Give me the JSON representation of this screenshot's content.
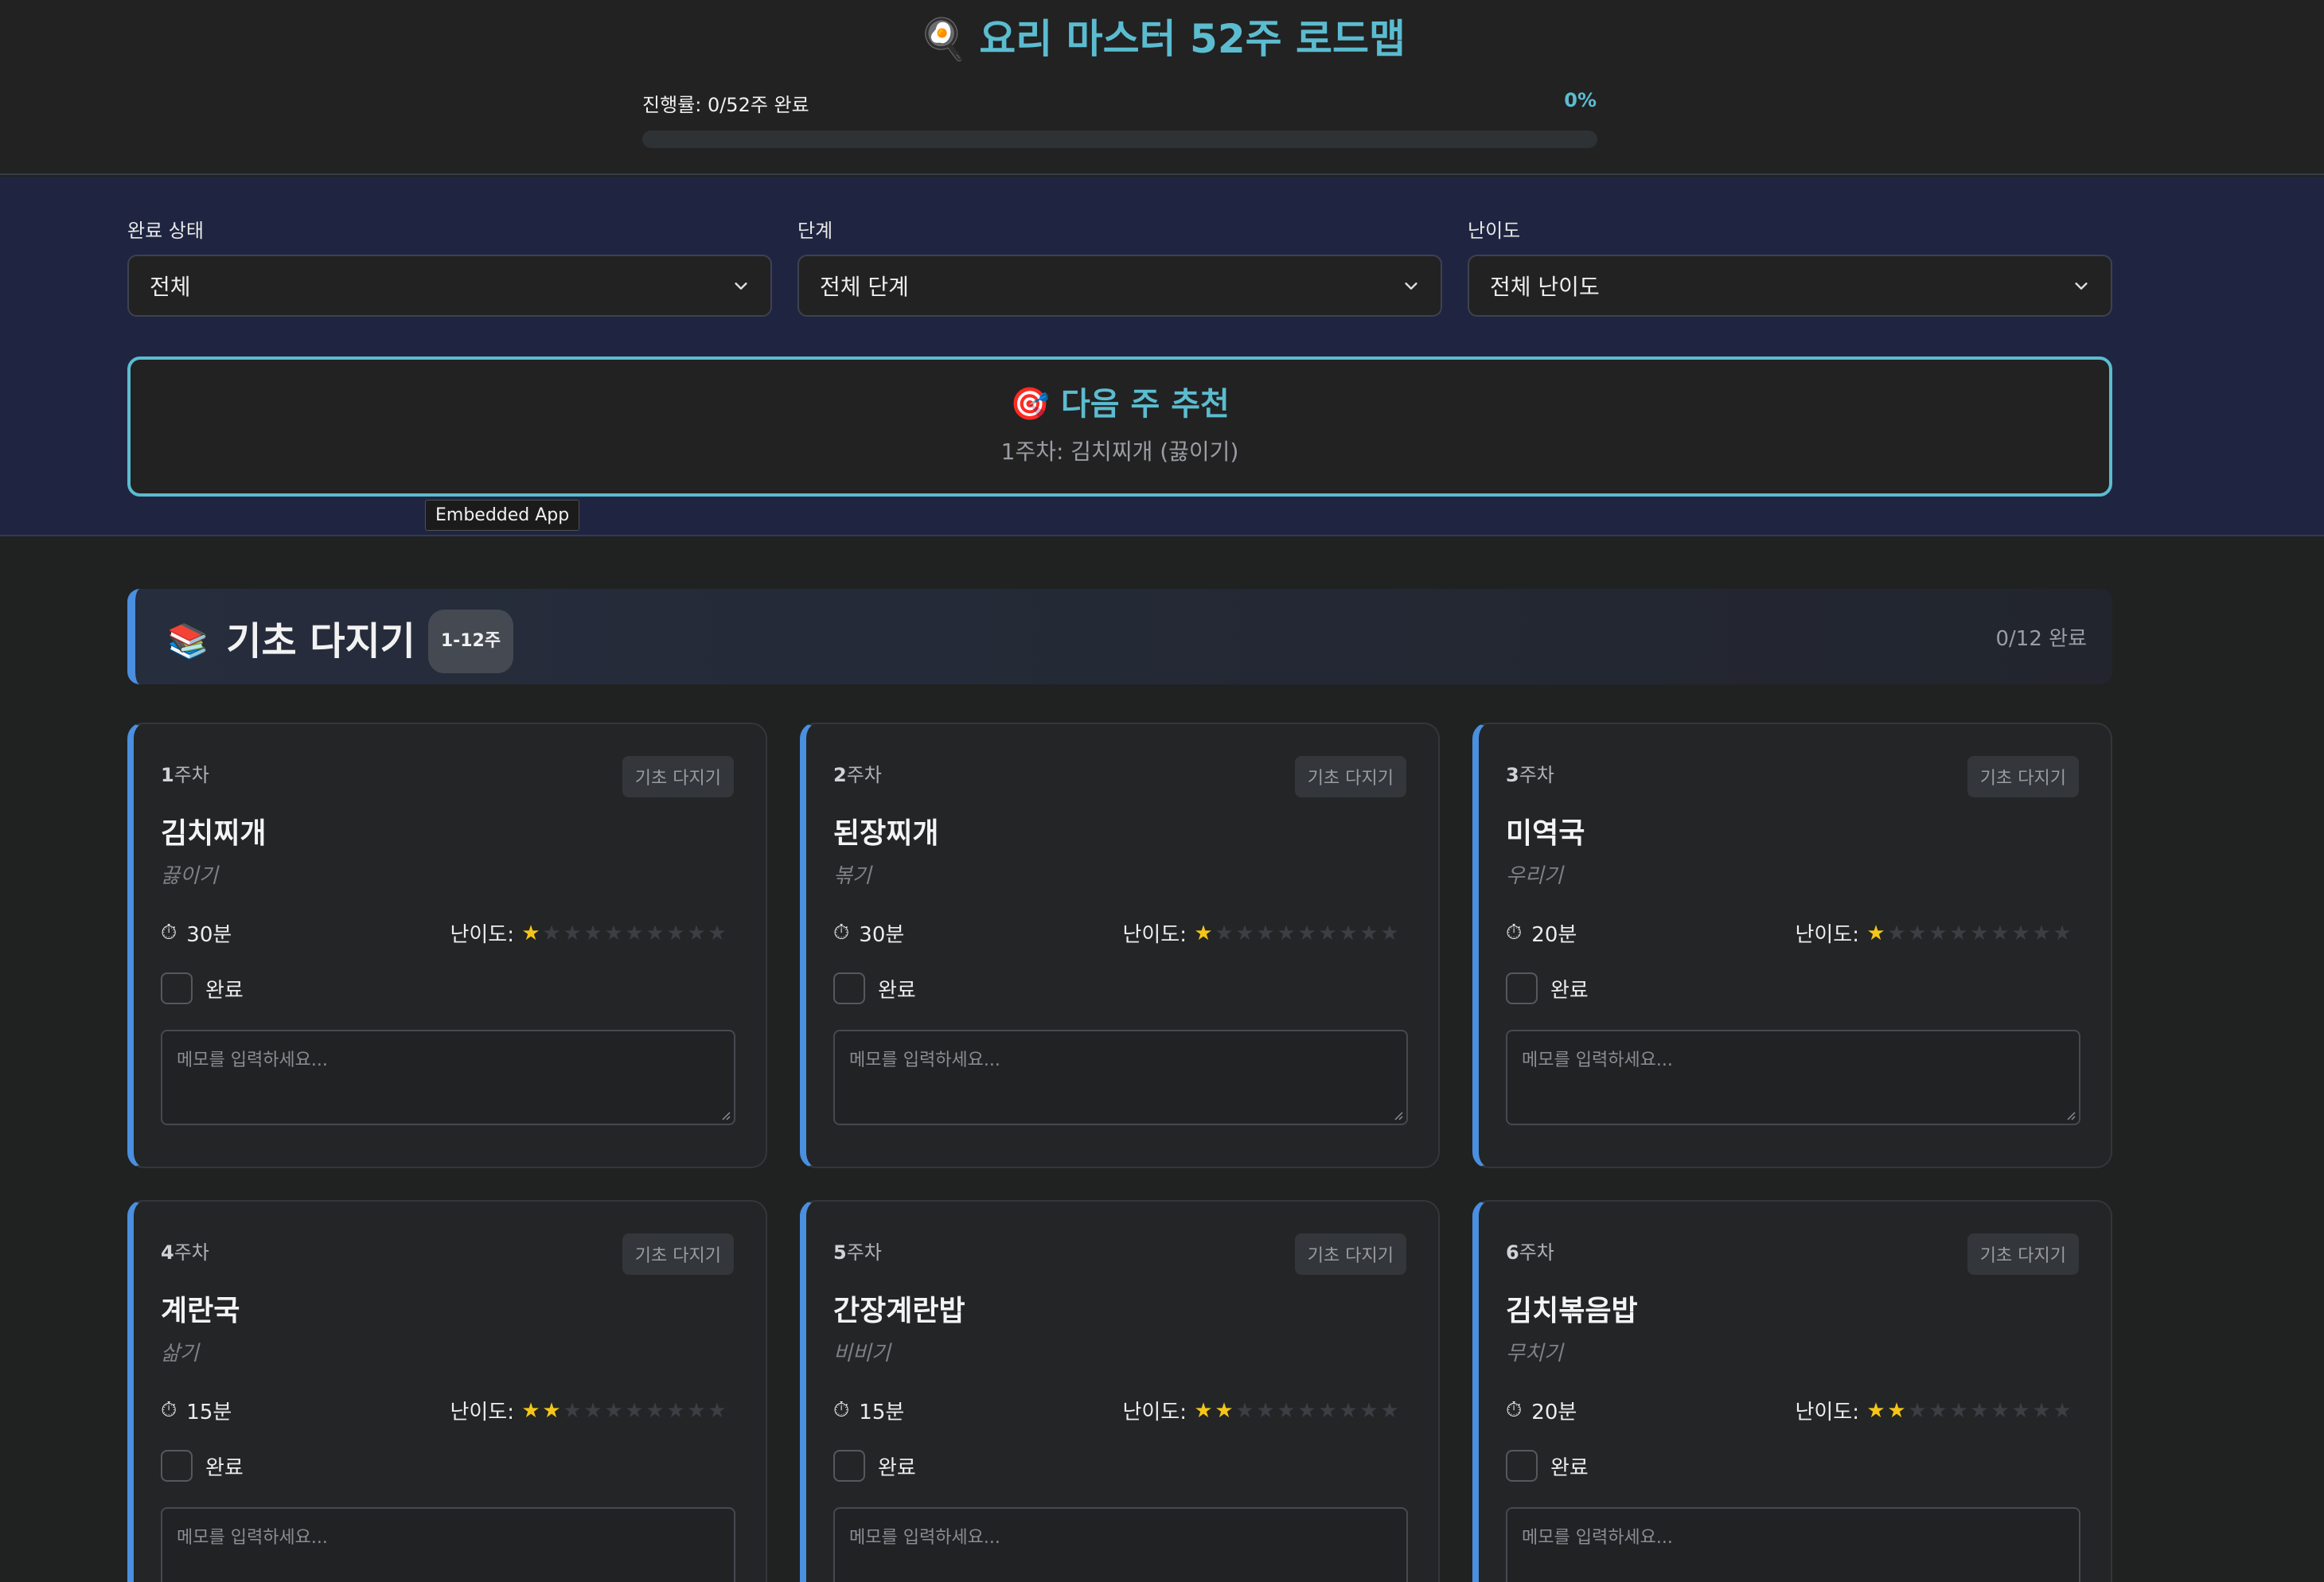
{
  "header": {
    "title": "요리 마스터 52주 로드맵",
    "title_icon": "frying-pan-icon",
    "progress_label": "진행률: 0/52주 완료",
    "progress_percent_text": "0%",
    "progress_value": 0
  },
  "filters": [
    {
      "label": "완료 상태",
      "selected": "전체"
    },
    {
      "label": "단계",
      "selected": "전체 단계"
    },
    {
      "label": "난이도",
      "selected": "전체 난이도"
    }
  ],
  "recommend": {
    "title": "다음 주 추천",
    "icon": "target-icon",
    "subtitle": "1주차: 김치찌개 (끓이기)"
  },
  "tooltip": "Embedded App",
  "section": {
    "icon": "books-icon",
    "title": "기초 다지기",
    "badge": "1-12주",
    "count": "0/12 완료"
  },
  "card_labels": {
    "week_suffix": "주차",
    "difficulty_label": "난이도:",
    "complete_label": "완료",
    "memo_placeholder": "메모를 입력하세요..."
  },
  "cards": [
    {
      "week": "1",
      "tag": "기초 다지기",
      "name": "김치찌개",
      "method": "끓이기",
      "time": "30분",
      "difficulty": 1
    },
    {
      "week": "2",
      "tag": "기초 다지기",
      "name": "된장찌개",
      "method": "볶기",
      "time": "30분",
      "difficulty": 1
    },
    {
      "week": "3",
      "tag": "기초 다지기",
      "name": "미역국",
      "method": "우리기",
      "time": "20분",
      "difficulty": 1
    },
    {
      "week": "4",
      "tag": "기초 다지기",
      "name": "계란국",
      "method": "삶기",
      "time": "15분",
      "difficulty": 2
    },
    {
      "week": "5",
      "tag": "기초 다지기",
      "name": "간장계란밥",
      "method": "비비기",
      "time": "15분",
      "difficulty": 2
    },
    {
      "week": "6",
      "tag": "기초 다지기",
      "name": "김치볶음밥",
      "method": "무치기",
      "time": "20분",
      "difficulty": 2
    }
  ],
  "difficulty_max": 10,
  "colors": {
    "accent": "#5bbcd0",
    "section_blue": "#4a8fe0",
    "star_on": "#f5c518",
    "background": "#202222",
    "filter_band": "#1f2541"
  }
}
